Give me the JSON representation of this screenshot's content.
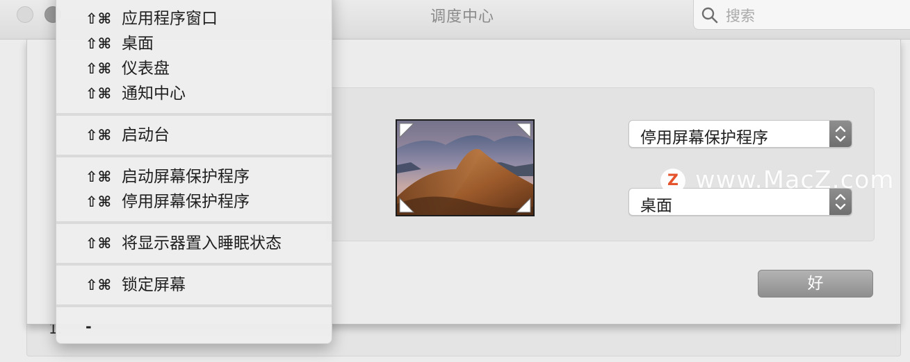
{
  "window": {
    "title": "调度中心",
    "search_placeholder": "搜索"
  },
  "background": {
    "fragment": "1."
  },
  "sheet": {
    "top_right_action": "停用屏幕保护程序",
    "bottom_right_action": "桌面",
    "ok_label": "好"
  },
  "menu": {
    "shortcut": "⇧⌘",
    "items": [
      "应用程序窗口",
      "桌面",
      "仪表盘",
      "通知中心",
      "启动台",
      "启动屏幕保护程序",
      "停用屏幕保护程序",
      "将显示器置入睡眠状态",
      "锁定屏幕"
    ],
    "none_label": "-"
  },
  "watermark": {
    "logo": "Z",
    "text": "www.MacZ.com"
  },
  "colors": {
    "window_bg": "#ececec",
    "button_gray": "#9e9e9e",
    "watermark_logo": "#e5532d"
  },
  "icons": [
    "search-icon",
    "chevron-updown-icon",
    "corner-triangle-icon"
  ]
}
